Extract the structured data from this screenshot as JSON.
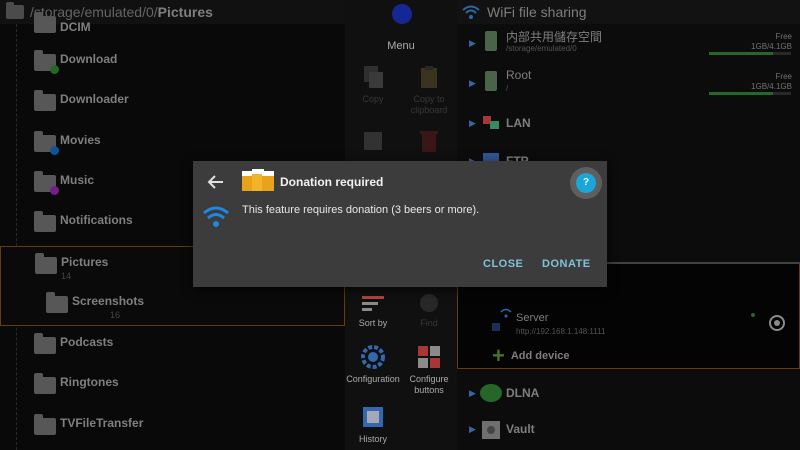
{
  "left_pane": {
    "path_prefix": "/storage/emulated/0/",
    "path_current": "Pictures",
    "folders": [
      {
        "name": "DCIM"
      },
      {
        "name": "Download"
      },
      {
        "name": "Downloader"
      },
      {
        "name": "Movies"
      },
      {
        "name": "Music"
      },
      {
        "name": "Notifications"
      },
      {
        "name": "Pictures",
        "sub": "14"
      },
      {
        "name": "Screenshots",
        "sub": "16"
      },
      {
        "name": "Podcasts"
      },
      {
        "name": "Ringtones"
      },
      {
        "name": "TVFileTransfer"
      }
    ]
  },
  "menu": {
    "title": "Menu",
    "items": {
      "copy": "Copy",
      "copy_to": "Copy to clipboard",
      "sort_by": "Sort by",
      "find": "Find",
      "configuration": "Configuration",
      "configure_buttons": "Configure buttons",
      "history": "History"
    }
  },
  "right_pane": {
    "title": "WiFi file sharing",
    "storages": [
      {
        "name": "内部共用儲存空間",
        "path": "/storage/emulated/0",
        "free_label": "Free",
        "size": "1GB/4.1GB",
        "used_fraction": 0.78
      },
      {
        "name": "Root",
        "path": "/",
        "free_label": "Free",
        "size": "1GB/4.1GB",
        "used_fraction": 0.78
      }
    ],
    "networks": {
      "lan": "LAN",
      "ftp": "FTP",
      "dlna": "DLNA",
      "vault": "Vault"
    },
    "server": {
      "name": "Server",
      "url": "http://192.168.1.148:1111"
    },
    "add_device": "Add device"
  },
  "dialog": {
    "title": "Donation required",
    "message": "This feature requires donation (3 beers or more).",
    "close": "CLOSE",
    "donate": "DONATE",
    "help_label": "?"
  },
  "colors": {
    "accent": "#7ec3da",
    "wifi_blue": "#1e88e5",
    "help_blue": "#1aa6d8",
    "selection_border": "#7a4a12"
  }
}
